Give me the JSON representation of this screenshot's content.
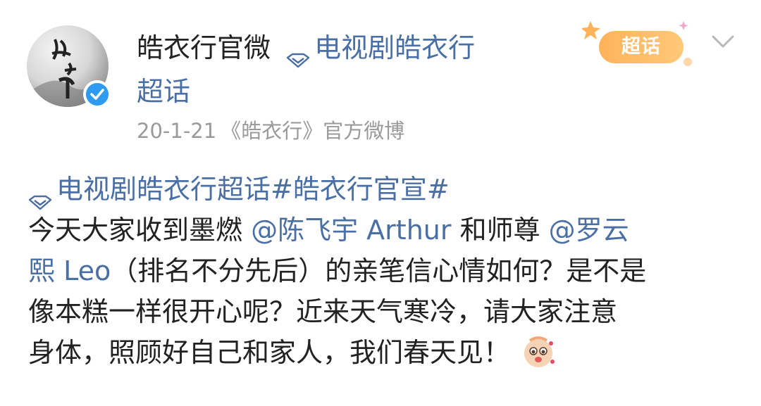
{
  "post": {
    "author": {
      "name": "皓衣行官微",
      "verified": true
    },
    "topic_tag": {
      "icon": "super-topic-diamond-icon",
      "label_line1": "电视剧皓衣行",
      "label_line2": "超话"
    },
    "meta": {
      "date": "20-1-21",
      "source": "《皓衣行》官方微博"
    },
    "super_badge_label": "超话",
    "content": {
      "line1": {
        "topic": "电视剧皓衣行超话",
        "hashtag": "#皓衣行官宣#"
      },
      "line2": {
        "text_a": "今天大家收到墨燃 ",
        "mention1": "@陈飞宇 Arthur",
        "text_b": " 和师尊 ",
        "mention2_part1": "@罗云"
      },
      "line3": {
        "mention2_part2": "熙 Leo",
        "text": "（排名不分先后）的亲笔信心情如何？是不是"
      },
      "line4": "像本糕一样很开心呢？近来天气寒冷，请大家注意",
      "line5": "身体，照顾好自己和家人，我们春天见！",
      "emoji": "happy-sticker-icon"
    },
    "colors": {
      "link": "#4a6fa5",
      "text": "#222222",
      "meta": "#9a9a9a",
      "verified": "#2e9bf0",
      "badge": "#ffb25a"
    }
  }
}
